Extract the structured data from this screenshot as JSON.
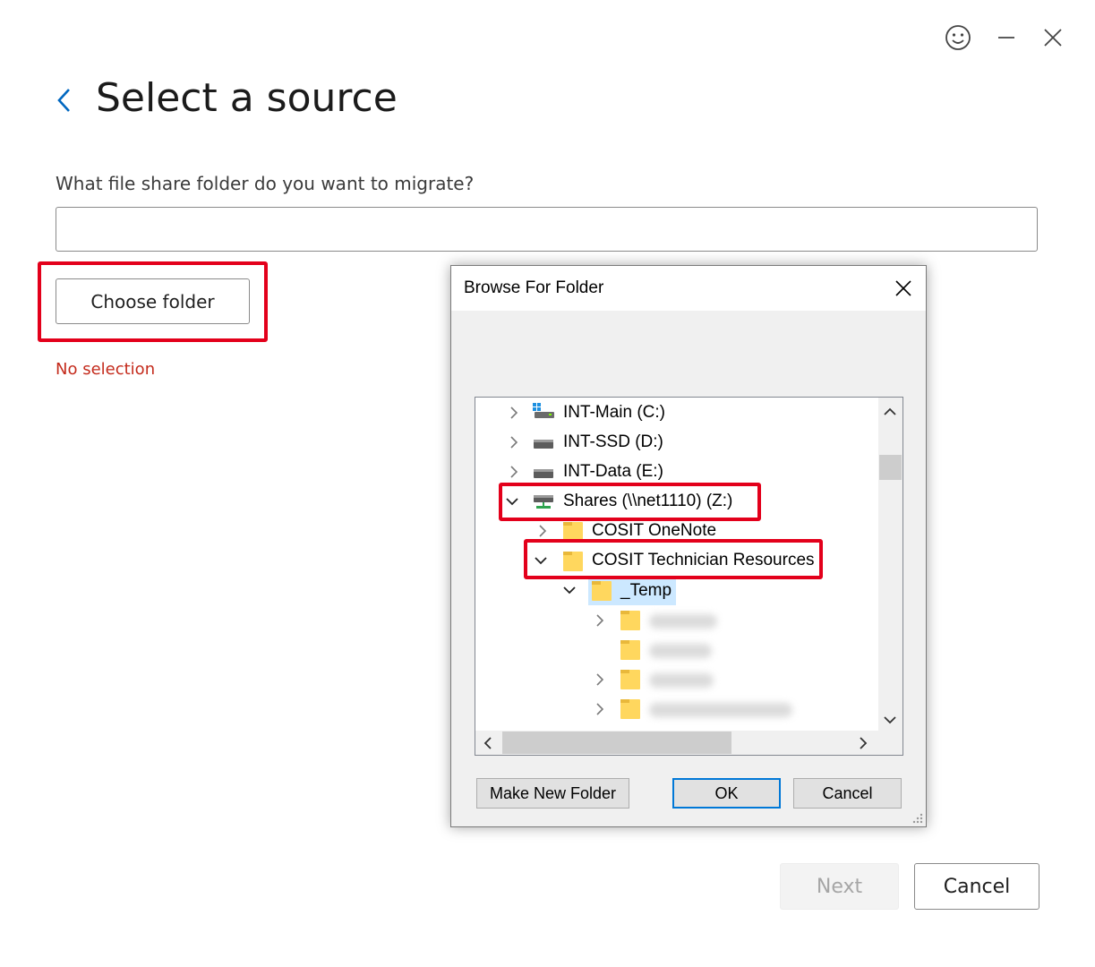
{
  "window": {
    "feedback_icon": "smiley-icon",
    "minimize_icon": "minimize-icon",
    "close_icon": "close-icon"
  },
  "header": {
    "title": "Select a source"
  },
  "form": {
    "question": "What file share folder do you want to migrate?",
    "path_value": "",
    "choose_folder_label": "Choose folder",
    "status_text": "No selection"
  },
  "footer": {
    "next_label": "Next",
    "cancel_label": "Cancel"
  },
  "dialog": {
    "title": "Browse For Folder",
    "tree": [
      {
        "label": "INT-Main (C:)",
        "expanded": false,
        "icon": "system-drive-icon"
      },
      {
        "label": "INT-SSD (D:)",
        "expanded": false,
        "icon": "drive-icon"
      },
      {
        "label": "INT-Data (E:)",
        "expanded": false,
        "icon": "drive-icon"
      },
      {
        "label": "Shares (\\\\net1110) (Z:)",
        "expanded": true,
        "icon": "network-drive-icon"
      },
      {
        "label": "COSIT OneNote",
        "expanded": false,
        "icon": "folder-icon"
      },
      {
        "label": "COSIT Technician Resources",
        "expanded": true,
        "icon": "folder-icon"
      },
      {
        "label": "_Temp",
        "expanded": true,
        "icon": "folder-icon",
        "selected": true
      }
    ],
    "make_new_folder_label": "Make New Folder",
    "ok_label": "OK",
    "cancel_label": "Cancel"
  },
  "colors": {
    "accent": "#0067c0",
    "highlight": "#e3001b",
    "error_text": "#c42b1c",
    "selection": "#cce8ff"
  }
}
